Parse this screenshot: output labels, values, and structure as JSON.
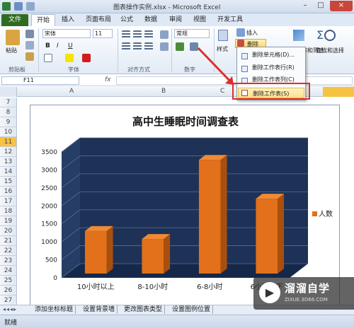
{
  "window": {
    "title": "图表操作实例.xlsx - Microsoft Excel",
    "controls": [
      "–",
      "□",
      "×"
    ]
  },
  "tabs": [
    "文件",
    "开始",
    "插入",
    "页面布局",
    "公式",
    "数据",
    "审阅",
    "视图",
    "开发工具"
  ],
  "ribbon": {
    "paste": "粘贴",
    "font_name": "宋体",
    "font_size": "11",
    "bold": "B",
    "italic": "I",
    "underline": "U",
    "number_format": "常规",
    "style_btn": "样式",
    "insert_btn": "插入",
    "delete_btn": "删除",
    "sort_filter": "排序和筛选",
    "find_select": "查找和选择",
    "sigma": "Σ",
    "groups": {
      "clipboard": "剪贴板",
      "font": "字体",
      "alignment": "对齐方式",
      "number": "数字"
    }
  },
  "formula_bar": {
    "name_box": "F11",
    "fx": "fx",
    "value": ""
  },
  "columns": [
    "A",
    "B",
    "C"
  ],
  "rows": [
    "7",
    "8",
    "9",
    "10",
    "11",
    "12",
    "13",
    "14",
    "15",
    "16",
    "17",
    "18",
    "19",
    "20",
    "21",
    "22",
    "23",
    "24",
    "25",
    "26",
    "27"
  ],
  "menu": {
    "items": [
      "删除单元格(D)...",
      "删除工作表行(R)",
      "删除工作表列(C)",
      "删除工作表(S)"
    ],
    "highlighted": "删除工作表(S)"
  },
  "chart_data": {
    "type": "bar",
    "title": "高中生睡眠时间调查表",
    "categories": [
      "10小时以上",
      "8-10小时",
      "6-8小时",
      "6小时以下"
    ],
    "series": [
      {
        "name": "人数",
        "values": [
          1300,
          1080,
          3280,
          2200
        ]
      }
    ],
    "ylim": [
      0,
      3500
    ],
    "yticks": [
      "0",
      "500",
      "1000",
      "1500",
      "2000",
      "2500",
      "3000",
      "3500"
    ],
    "legend_position": "right",
    "bar_color": "#e3701a",
    "background": "#1e3257",
    "grid": true
  },
  "sheet_tabs": [
    "添加坐标标题",
    "设置背景墙",
    "更改图表类型",
    "设置图例位置"
  ],
  "status": {
    "ready": "就绪"
  },
  "watermark": {
    "name": "溜溜自学",
    "url": "ZIXUE.3D66.COM"
  },
  "colors": {
    "accent": "#2f6c22",
    "highlight_box": "#d9302a"
  }
}
